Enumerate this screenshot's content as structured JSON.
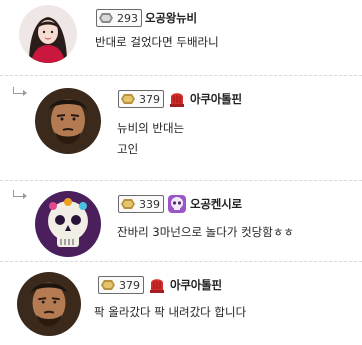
{
  "comments": [
    {
      "level": "293",
      "nickname": "오공왕뉴비",
      "lines": [
        "반대로 걸었다면 두배라니"
      ],
      "is_reply": false,
      "avatar": "girl-portrait"
    },
    {
      "level": "379",
      "nickname": "아쿠아톨핀",
      "lines": [
        "뉴비의 반대는",
        "고인"
      ],
      "is_reply": true,
      "avatar": "warrior-portrait",
      "emblem": "red-bell-emblem"
    },
    {
      "level": "339",
      "nickname": "오공켄시로",
      "lines": [
        "잔바리 3마넌으로 놀다가 컷당함ㅎㅎ"
      ],
      "is_reply": true,
      "avatar": "skull-portrait",
      "emblem": "purple-skull-emblem"
    },
    {
      "level": "379",
      "nickname": "아쿠아톨핀",
      "lines": [
        "팍 올라갔다 팍 내려갔다 합니다"
      ],
      "is_reply": false,
      "avatar": "warrior-portrait",
      "emblem": "red-bell-emblem"
    }
  ],
  "colors": {
    "level_gold": "#c9a24a",
    "level_gray": "#7a7a7a",
    "emblem_red": "#d42b2b",
    "emblem_purple": "#9a55c8",
    "divider": "#d8d8d8"
  }
}
